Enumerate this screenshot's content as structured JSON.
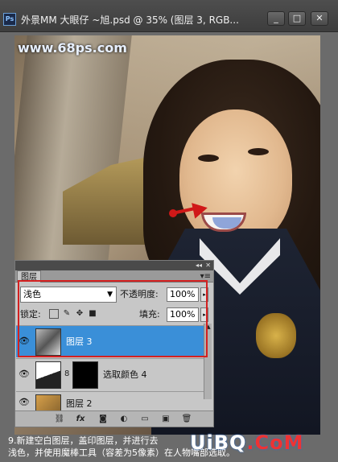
{
  "window": {
    "app_icon_label": "Ps",
    "title": "外景MM 大眼仔 ~旭.psd @ 35% (图层 3, RGB...",
    "min_label": "_",
    "max_label": "□",
    "close_label": "✕"
  },
  "watermark": {
    "top": "www.68ps.com",
    "bottom_brand": "UiBQ",
    "bottom_domain": ".CoM"
  },
  "layers_panel": {
    "collapse": "◂◂",
    "close": "✕",
    "tab": "图层",
    "menu": "▾≡",
    "blend_mode": "浅色",
    "opacity_label": "不透明度:",
    "opacity_value": "100%",
    "lock_label": "锁定:",
    "fill_label": "填充:",
    "fill_value": "100%",
    "layers": [
      {
        "name": "图层 3",
        "selected": true
      },
      {
        "name": "选取颜色 4",
        "selected": false
      },
      {
        "name": "图层 2",
        "selected": false
      }
    ]
  },
  "caption": {
    "line1": "9.新建空白图层，盖印图层，并进行去",
    "line2": "浅色，并使用魔棒工具（容差为5像素）在人物嘴部选取。"
  },
  "colors": {
    "selection_blue": "#3a8fd8",
    "highlight_red": "#d42020"
  }
}
